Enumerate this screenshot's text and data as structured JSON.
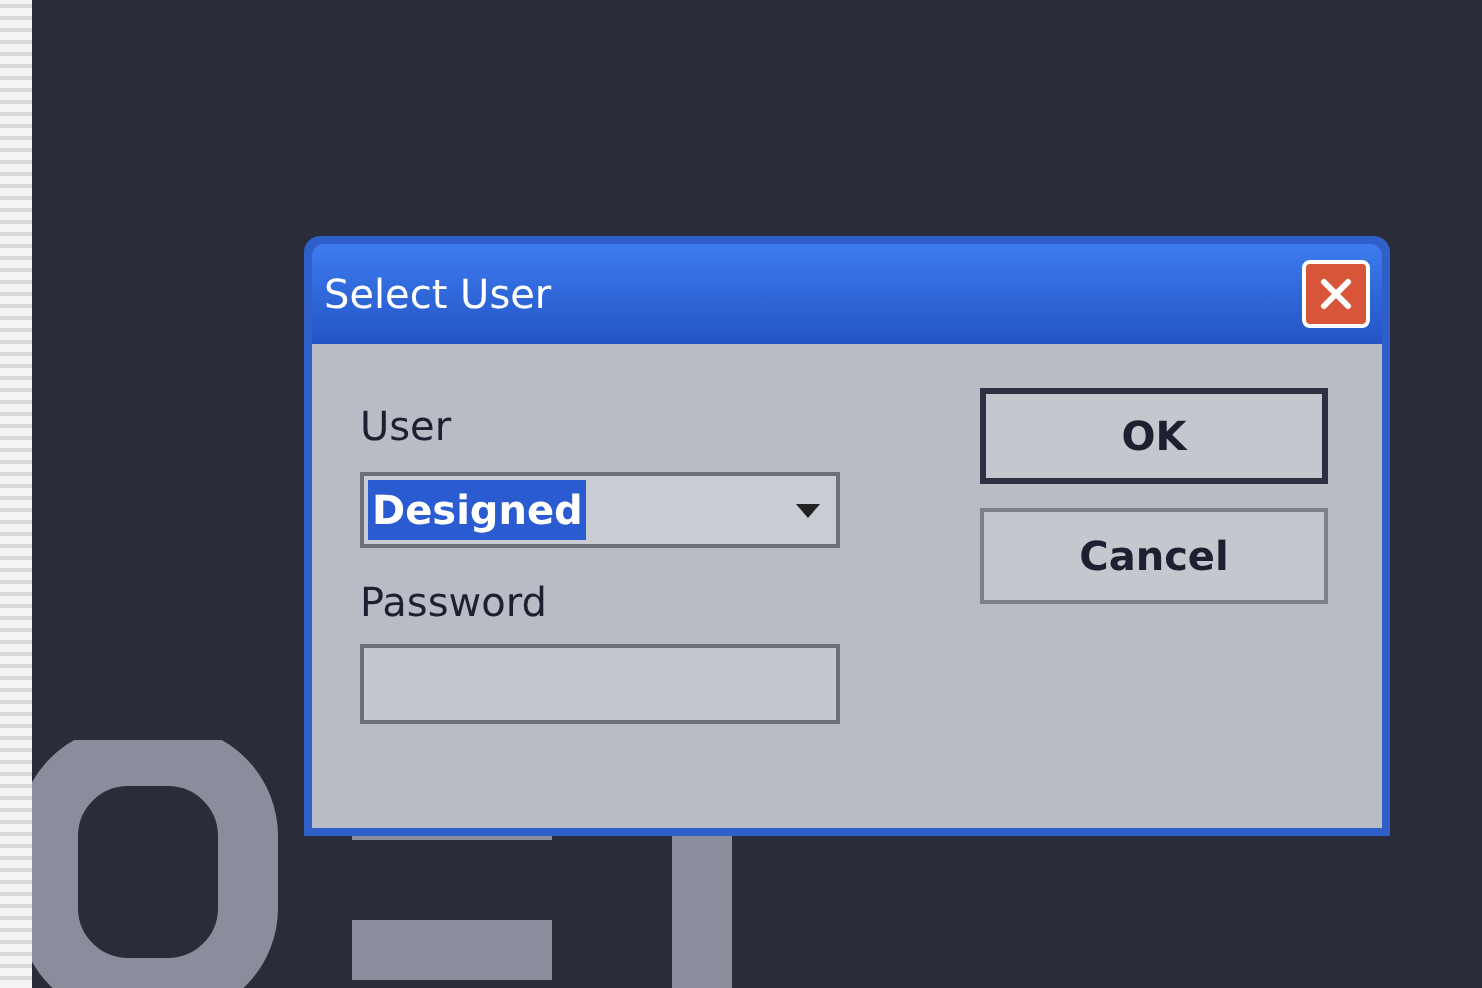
{
  "dialog": {
    "title": "Select User",
    "user": {
      "label": "User",
      "value": "Designed",
      "selected": true
    },
    "password": {
      "label": "Password"
    },
    "buttons": [
      {
        "label": "OK",
        "default": true
      },
      {
        "label": "Cancel",
        "default": false
      }
    ]
  }
}
